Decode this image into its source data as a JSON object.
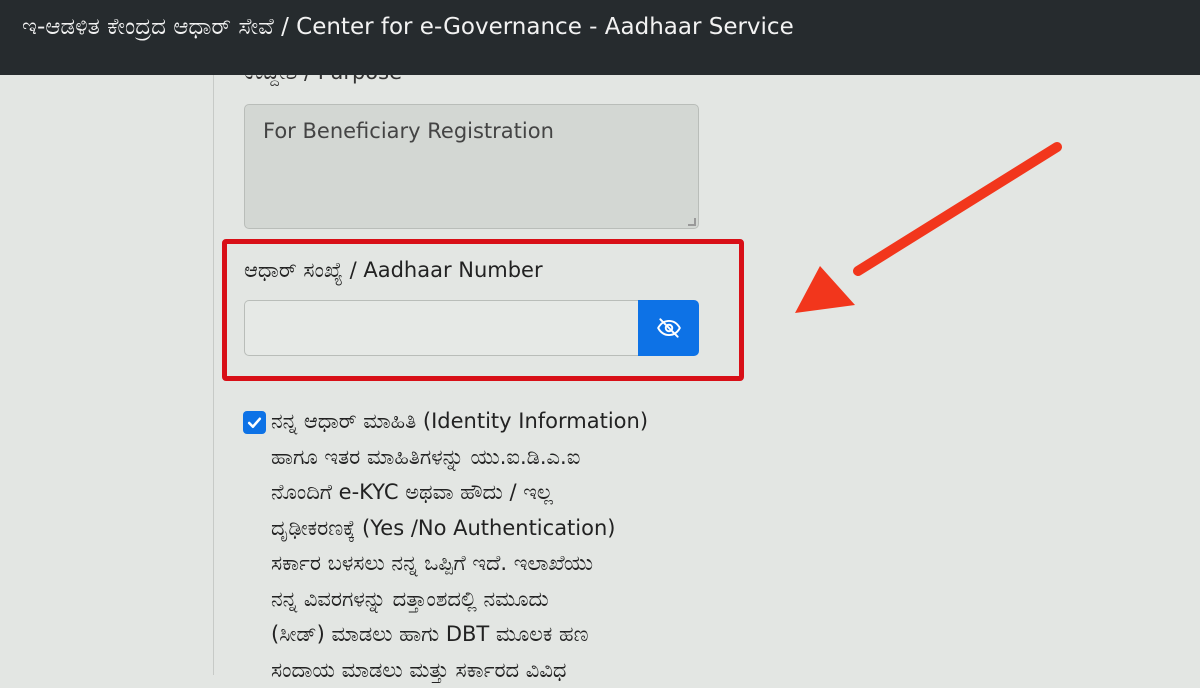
{
  "header": {
    "title": "ಇ-ಆಡಳಿತ ಕೇಂದ್ರದ ಆಧಾರ್ ಸೇವೆ / Center for e-Governance - Aadhaar Service"
  },
  "purpose": {
    "label": "ಉದ್ದೇಶ / Purpose",
    "value": "For Beneficiary Registration"
  },
  "aadhaar": {
    "label": "ಆಧಾರ್ ಸಂಖ್ಯೆ / Aadhaar Number",
    "value": "",
    "toggle_icon": "eye-slash-icon"
  },
  "consent": {
    "checked": true,
    "lines": [
      "ನನ್ನ ಆಧಾರ್ ಮಾಹಿತಿ (Identity Information)",
      "ಹಾಗೂ ಇತರ ಮಾಹಿತಿಗಳನ್ನು ಯು.ಐ.ಡಿ.ಎ.ಐ",
      "ನೊಂದಿಗೆ e-KYC ಅಥವಾ ಹೌದು / ಇಲ್ಲ",
      "ದೃಢೀಕರಣಕ್ಕೆ (Yes /No Authentication)",
      "ಸರ್ಕಾರ ಬಳಸಲು ನನ್ನ ಒಪ್ಪಿಗೆ ಇದೆ. ಇಲಾಖೆಯು",
      "ನನ್ನ ವಿವರಗಳನ್ನು ದತ್ತಾಂಶದಲ್ಲಿ ನಮೂದು",
      "(ಸೀಡ್) ಮಾಡಲು ಹಾಗು DBT ಮೂಲಕ ಹಣ",
      "ಸಂದಾಯ ಮಾಡಲು ಮತ್ತು ಸರ್ಕಾರದ ವಿವಿಧ"
    ]
  },
  "colors": {
    "header_bg": "#262b2e",
    "accent_blue": "#0d72e6",
    "highlight_red": "#d80f17",
    "annotation_arrow": "#f2361c"
  }
}
